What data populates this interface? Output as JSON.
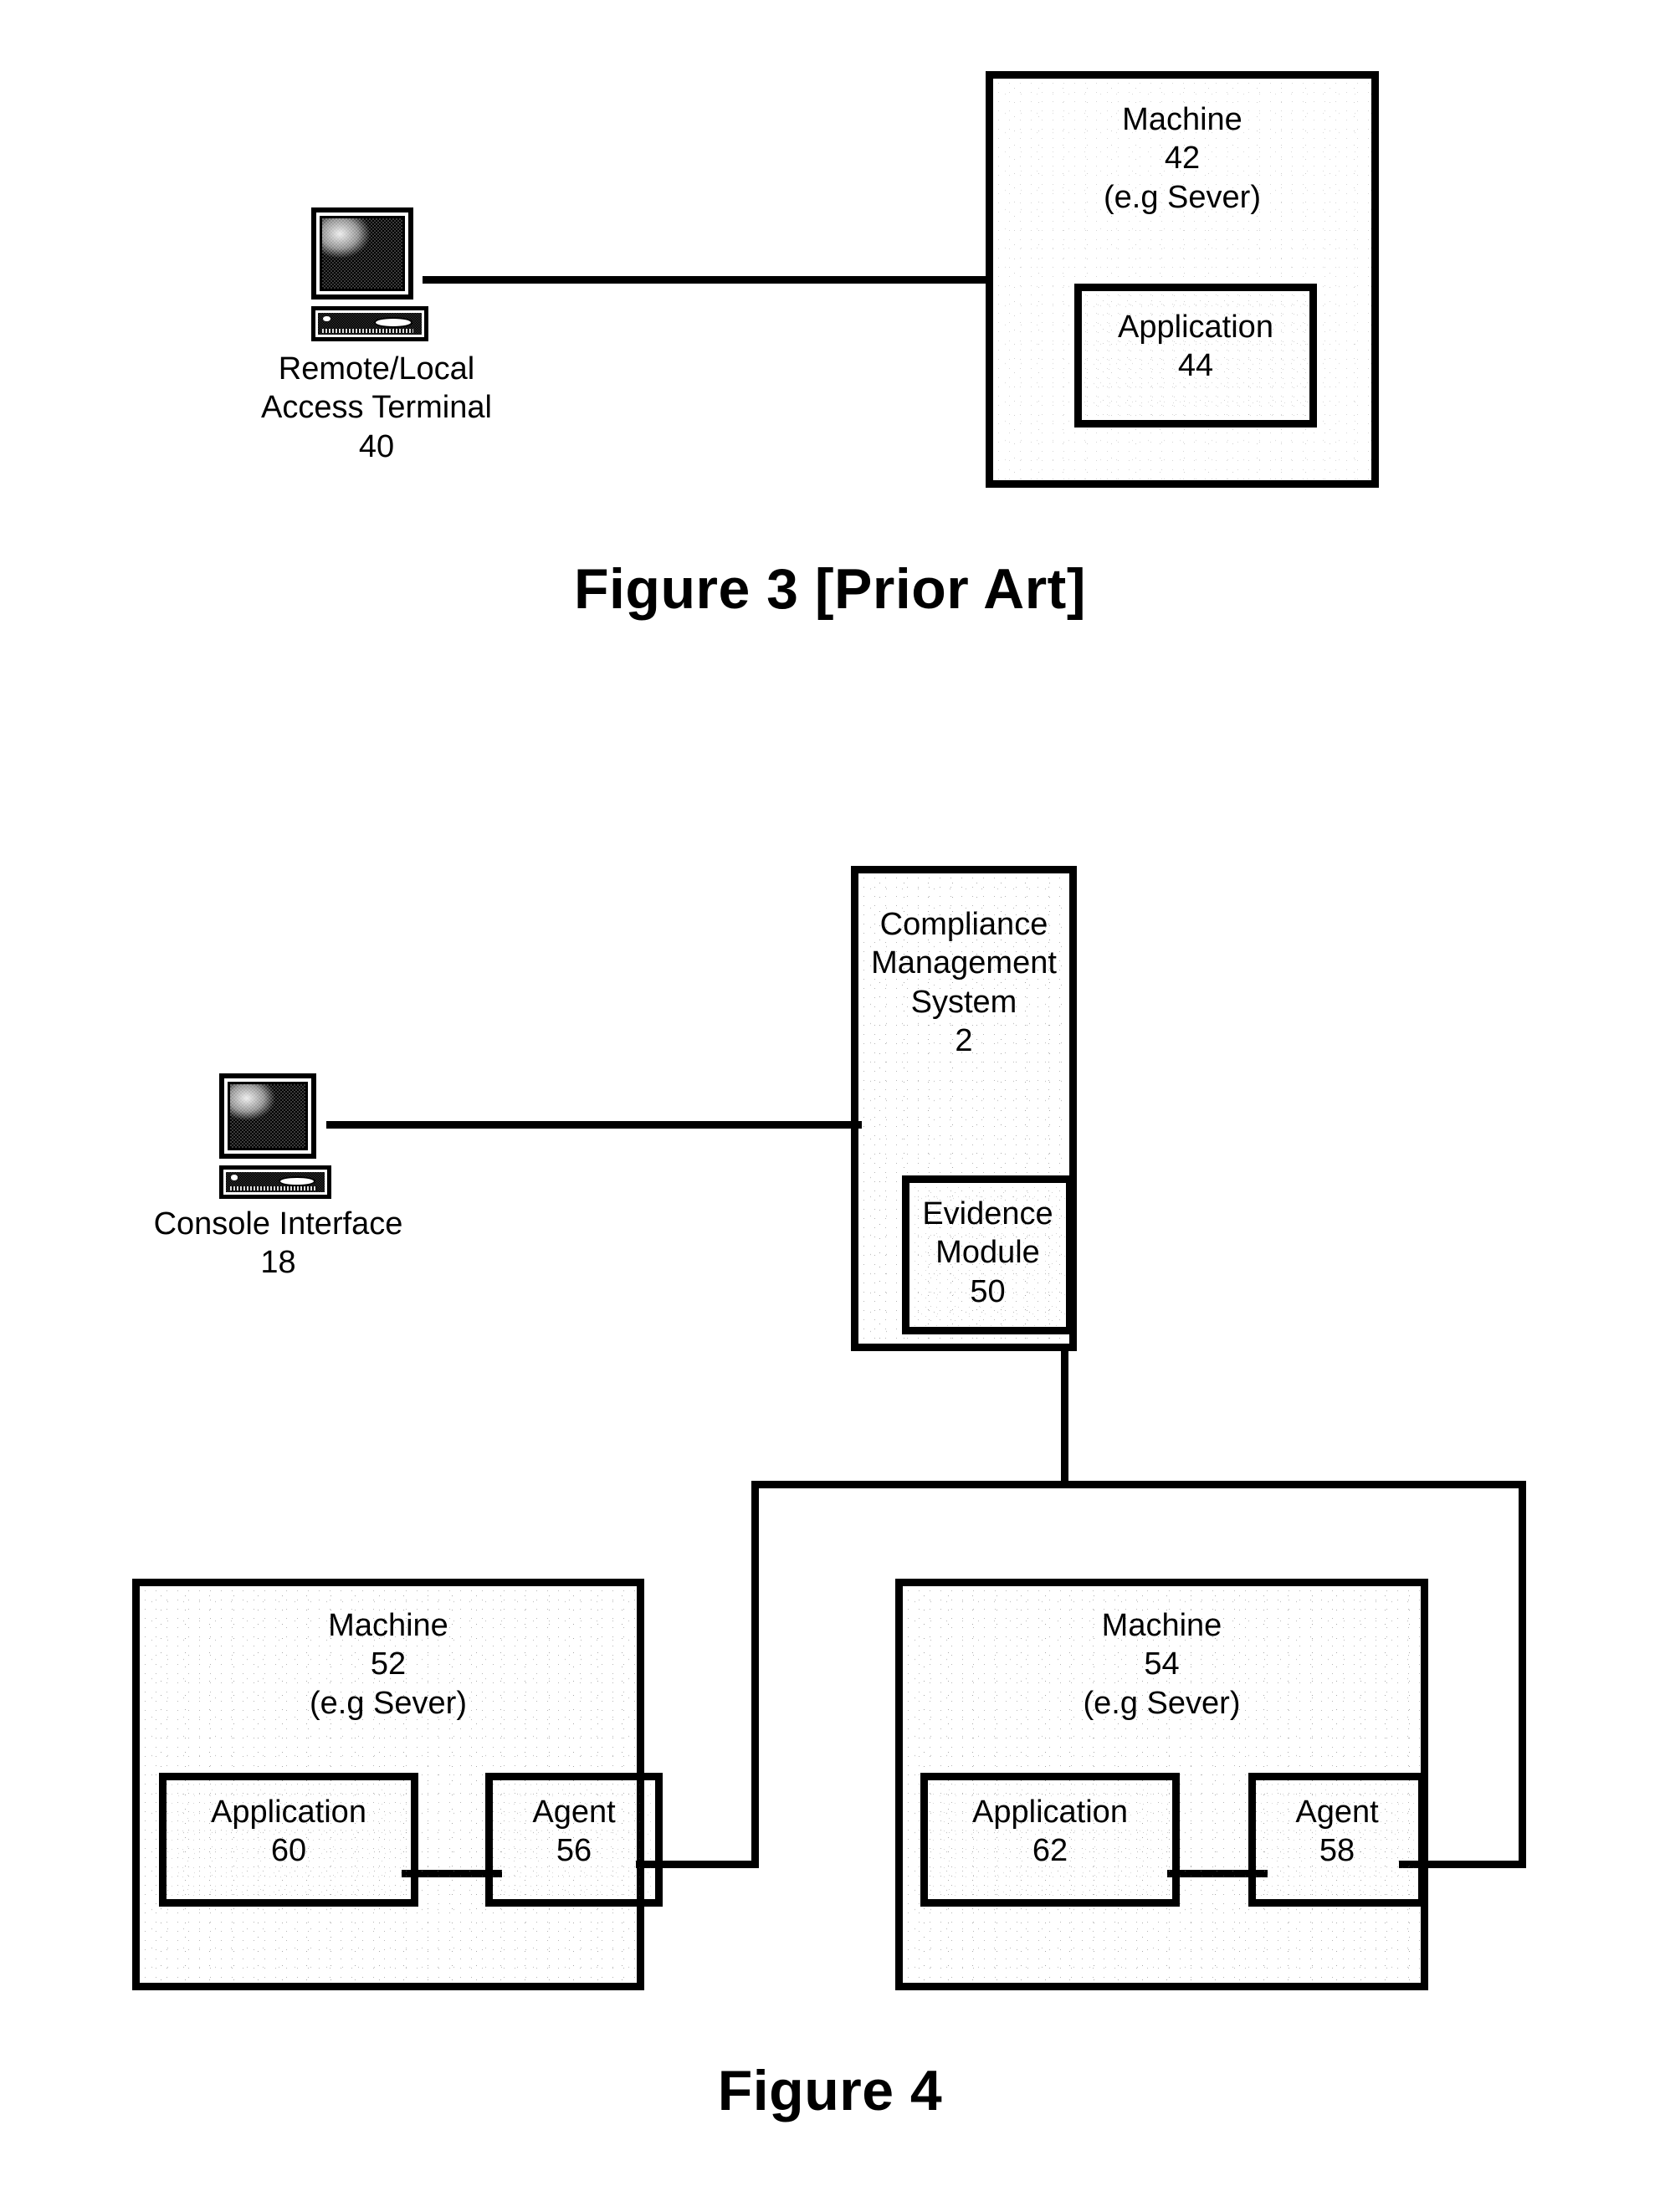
{
  "figure3": {
    "caption": "Figure 3 [Prior Art]",
    "terminal": {
      "icon": "computer-terminal-icon",
      "label": "Remote/Local\nAccess Terminal\n40"
    },
    "machine": {
      "label": "Machine\n42\n(e.g Sever)",
      "application": {
        "label": "Application\n44"
      }
    },
    "connector": "terminal-to-machine-link"
  },
  "figure4": {
    "caption": "Figure 4",
    "console": {
      "icon": "computer-terminal-icon",
      "label": "Console Interface\n18"
    },
    "cms": {
      "label": "Compliance\nManagement\nSystem\n2",
      "evidence_module": {
        "label": "Evidence\nModule\n50"
      }
    },
    "machines": [
      {
        "label": "Machine\n52\n(e.g Sever)",
        "application": {
          "label": "Application\n60"
        },
        "agent": {
          "label": "Agent\n56"
        }
      },
      {
        "label": "Machine\n54\n(e.g Sever)",
        "application": {
          "label": "Application\n62"
        },
        "agent": {
          "label": "Agent\n58"
        }
      }
    ]
  },
  "colors": {
    "ink": "#000000",
    "paper": "#ffffff"
  }
}
